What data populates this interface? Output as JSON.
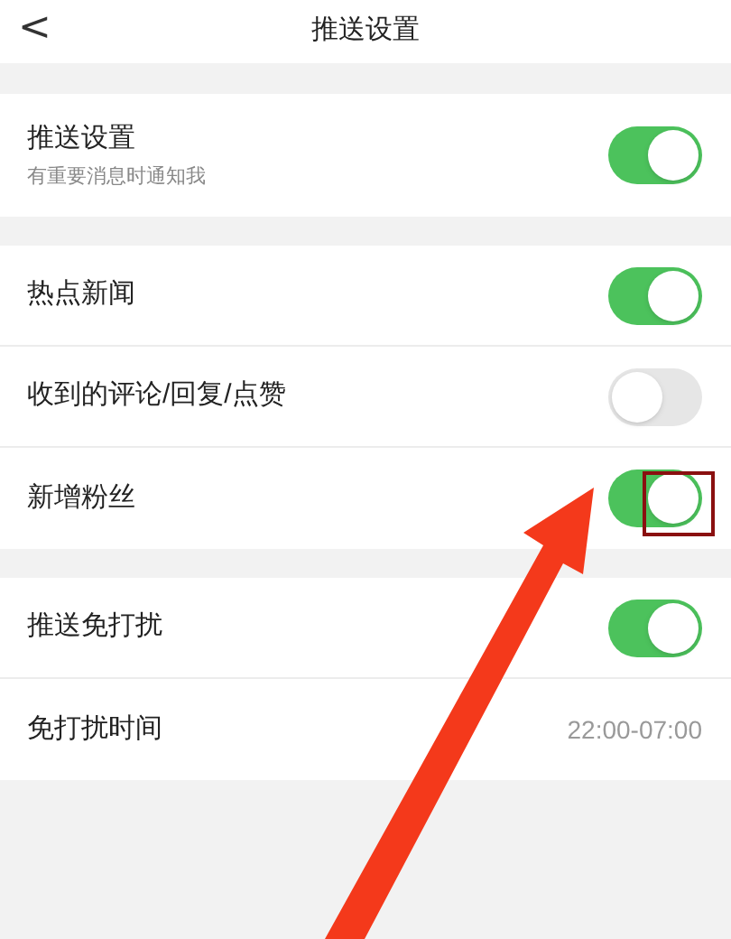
{
  "header": {
    "back": "<",
    "title": "推送设置"
  },
  "sections": [
    {
      "rows": [
        {
          "kind": "toggle",
          "label": "推送设置",
          "subtitle": "有重要消息时通知我",
          "on": true
        }
      ]
    },
    {
      "rows": [
        {
          "kind": "toggle",
          "label": "热点新闻",
          "on": true
        },
        {
          "kind": "toggle",
          "label": "收到的评论/回复/点赞",
          "on": false
        },
        {
          "kind": "toggle",
          "label": "新增粉丝",
          "on": true
        }
      ]
    },
    {
      "rows": [
        {
          "kind": "toggle",
          "label": "推送免打扰",
          "on": true
        },
        {
          "kind": "value",
          "label": "免打扰时间",
          "value": "22:00-07:00"
        }
      ]
    }
  ]
}
